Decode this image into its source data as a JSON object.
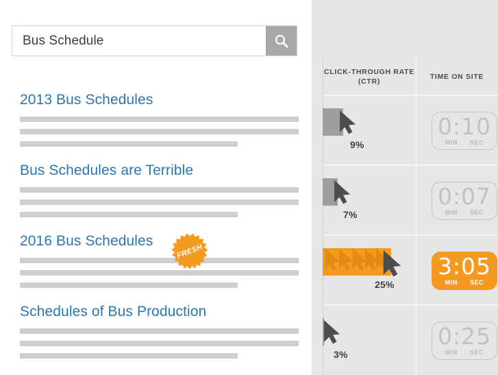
{
  "search": {
    "value": "Bus Schedule",
    "placeholder": "Search",
    "button_icon": "search-icon"
  },
  "results": [
    {
      "title": "2013 Bus Schedules",
      "snippet_lines": [
        "full",
        "full",
        "part"
      ],
      "badge": null
    },
    {
      "title": "Bus Schedules are Terrible",
      "snippet_lines": [
        "full",
        "full",
        "part"
      ],
      "badge": null
    },
    {
      "title": "2016 Bus Schedules",
      "snippet_lines": [
        "full",
        "full",
        "part"
      ],
      "badge": "FRESH"
    },
    {
      "title": "Schedules of Bus Production",
      "snippet_lines": [
        "full",
        "full",
        "part"
      ],
      "badge": null
    }
  ],
  "panel": {
    "columns": [
      "CLICK-THROUGH RATE (CTR)",
      "TIME ON SITE"
    ],
    "rows": [
      {
        "ctr": "9%",
        "ctr_bar_width": 30,
        "highlight": false,
        "time": "0:10",
        "min_label": "MIN",
        "sec_label": "SEC"
      },
      {
        "ctr": "7%",
        "ctr_bar_width": 22,
        "highlight": false,
        "time": "0:07",
        "min_label": "MIN",
        "sec_label": "SEC"
      },
      {
        "ctr": "25%",
        "ctr_bar_width": 100,
        "highlight": true,
        "time": "3:05",
        "min_label": "MIN",
        "sec_label": "SEC"
      },
      {
        "ctr": "3%",
        "ctr_bar_width": 2,
        "highlight": false,
        "time": "0:25",
        "min_label": "MIN",
        "sec_label": "SEC"
      }
    ]
  },
  "colors": {
    "link": "#2b77ad",
    "accent_orange": "#f49a20",
    "bar_grey": "#9e9e9e",
    "cursor_dark": "#4d4d4d",
    "panel_bg": "#e6e6e6",
    "placeholder_line": "#cfcfcf"
  },
  "chart_data": {
    "type": "table",
    "title": "",
    "columns": [
      "CLICK-THROUGH RATE (CTR)",
      "TIME ON SITE"
    ],
    "row_labels": [
      "2013 Bus Schedules",
      "Bus Schedules are Terrible",
      "2016 Bus Schedules",
      "Schedules of Bus Production"
    ],
    "series": [
      {
        "name": "CLICK-THROUGH RATE (CTR)",
        "unit": "%",
        "values": [
          9,
          7,
          25,
          3
        ]
      },
      {
        "name": "TIME ON SITE",
        "unit": "min:sec",
        "values": [
          "0:10",
          "0:07",
          "3:05",
          "0:25"
        ]
      }
    ],
    "highlighted_row_index": 2,
    "grid": true,
    "legend": "none"
  }
}
